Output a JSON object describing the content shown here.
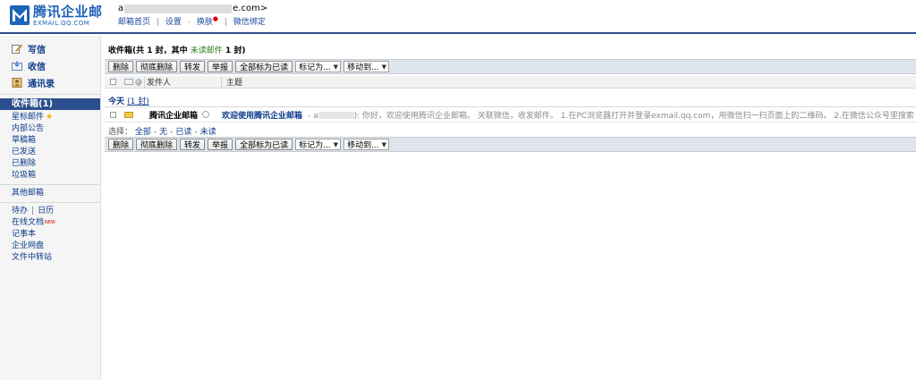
{
  "colors": {
    "brand": "#1d63b6",
    "header_rule": "#2b4e8c",
    "unread_green": "#2c7e1c",
    "link": "#0b3a8a"
  },
  "logo": {
    "name_cn": "腾讯企业邮",
    "name_en": "EXMAIL.QQ.COM"
  },
  "header": {
    "account_prefix": "a",
    "account_suffix": "e.com>",
    "links": {
      "home": "邮箱首页",
      "settings": "设置",
      "skin": "换肤",
      "wechat": "微信绑定"
    },
    "sep": "|",
    "dash": "-",
    "new_dot": "●"
  },
  "nav": {
    "quick": [
      {
        "label": "写信",
        "icon": "compose-icon"
      },
      {
        "label": "收信",
        "icon": "inbox-icon"
      },
      {
        "label": "通讯录",
        "icon": "contacts-icon"
      }
    ],
    "active_folder": "收件箱(1)",
    "folders": {
      "starred": "星标邮件",
      "internal": "内部公告",
      "drafts": "草稿箱",
      "sent": "已发送",
      "deleted": "已删除",
      "spam": "垃圾箱"
    },
    "other_mailbox": "其他邮箱",
    "tools": {
      "todo": "待办",
      "calendar": "日历",
      "docs": "在线文档",
      "docs_badge": "NEW",
      "notes": "记事本",
      "disk": "企业网盘",
      "transfer": "文件中转站"
    }
  },
  "main": {
    "title_bold": "收件箱",
    "title_count": "(共 1 封，其中 ",
    "title_unread": "未读邮件",
    "title_tail": " 1 封)",
    "toolbar": {
      "delete": "删除",
      "purge": "彻底删除",
      "forward": "转发",
      "report": "举报",
      "mark_all_read": "全部标为已读",
      "mark_as": "标记为...",
      "move_to": "移动到..."
    },
    "columns": {
      "sender": "发件人",
      "subject": "主题",
      "attach": "@"
    },
    "group": {
      "label": "今天",
      "count": "(1 封)"
    },
    "mail": {
      "sender": "腾讯企业邮箱",
      "subject": "欢迎使用腾讯企业邮箱",
      "preview_lead": " - a",
      "preview": "): 你好，欢迎使用腾讯企业邮箱。 关联微信，收发邮件。 1.在PC浏览器打开并登录exmail.qq.com，用微信扫一扫页面上的二维码。 2.在微信公众号里搜索"
    },
    "select": {
      "label": "选择：",
      "all": "全部",
      "none": "无",
      "read": "已读",
      "unread": "未读"
    }
  }
}
